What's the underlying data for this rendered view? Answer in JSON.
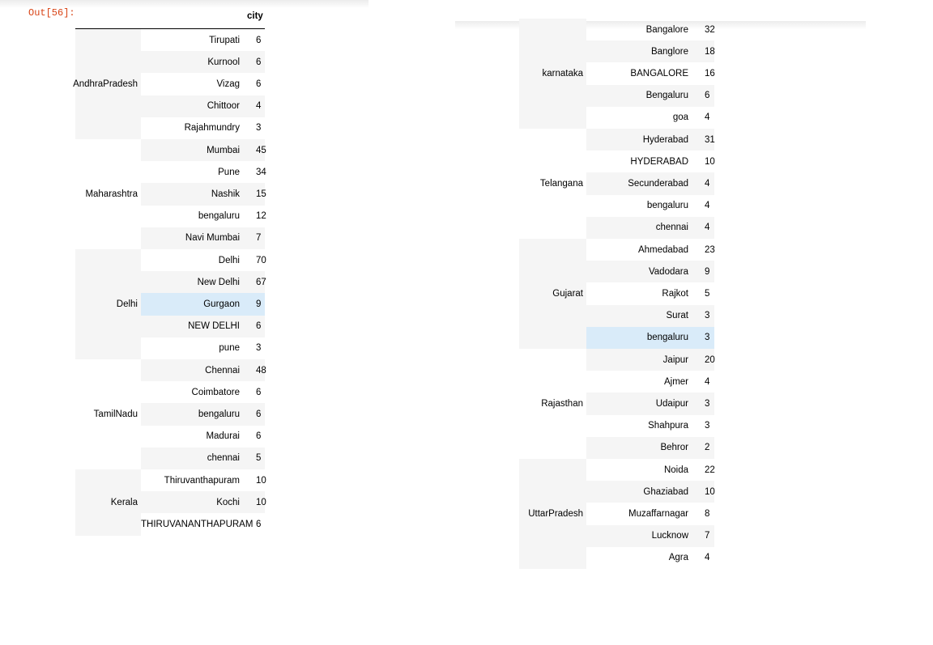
{
  "prompt_label": "Out[56]:",
  "header": {
    "column": "city"
  },
  "left_groups": [
    {
      "state": "AndhraPradesh",
      "rows": [
        {
          "city": "Tirupati",
          "count": "6"
        },
        {
          "city": "Kurnool",
          "count": "6"
        },
        {
          "city": "Vizag",
          "count": "6"
        },
        {
          "city": "Chittoor",
          "count": "4"
        },
        {
          "city": "Rajahmundry",
          "count": "3"
        }
      ]
    },
    {
      "state": "Maharashtra",
      "rows": [
        {
          "city": "Mumbai",
          "count": "45"
        },
        {
          "city": "Pune",
          "count": "34"
        },
        {
          "city": "Nashik",
          "count": "15"
        },
        {
          "city": "bengaluru",
          "count": "12"
        },
        {
          "city": "Navi Mumbai",
          "count": "7"
        }
      ]
    },
    {
      "state": "Delhi",
      "rows": [
        {
          "city": "Delhi",
          "count": "70"
        },
        {
          "city": "New Delhi",
          "count": "67"
        },
        {
          "city": "Gurgaon",
          "count": "9",
          "hover": true
        },
        {
          "city": "NEW DELHI",
          "count": "6"
        },
        {
          "city": "pune",
          "count": "3"
        }
      ]
    },
    {
      "state": "TamilNadu",
      "rows": [
        {
          "city": "Chennai",
          "count": "48"
        },
        {
          "city": "Coimbatore",
          "count": "6"
        },
        {
          "city": "bengaluru",
          "count": "6"
        },
        {
          "city": "Madurai",
          "count": "6"
        },
        {
          "city": "chennai",
          "count": "5"
        }
      ]
    },
    {
      "state": "Kerala",
      "rows": [
        {
          "city": "Thiruvanthapuram",
          "count": "10"
        },
        {
          "city": "Kochi",
          "count": "10"
        },
        {
          "city": "THIRUVANANTHAPURAM",
          "count": "6"
        }
      ]
    }
  ],
  "right_groups": [
    {
      "state": "karnataka",
      "rows": [
        {
          "city": "Bangalore",
          "count": "32"
        },
        {
          "city": "Banglore",
          "count": "18"
        },
        {
          "city": "BANGALORE",
          "count": "16"
        },
        {
          "city": "Bengaluru",
          "count": "6"
        },
        {
          "city": "goa",
          "count": "4"
        }
      ]
    },
    {
      "state": "Telangana",
      "rows": [
        {
          "city": "Hyderabad",
          "count": "31"
        },
        {
          "city": "HYDERABAD",
          "count": "10"
        },
        {
          "city": "Secunderabad",
          "count": "4"
        },
        {
          "city": "bengaluru",
          "count": "4"
        },
        {
          "city": "chennai",
          "count": "4"
        }
      ]
    },
    {
      "state": "Gujarat",
      "rows": [
        {
          "city": "Ahmedabad",
          "count": "23"
        },
        {
          "city": "Vadodara",
          "count": "9"
        },
        {
          "city": "Rajkot",
          "count": "5"
        },
        {
          "city": "Surat",
          "count": "3"
        },
        {
          "city": "bengaluru",
          "count": "3",
          "hover": true
        }
      ]
    },
    {
      "state": "Rajasthan",
      "rows": [
        {
          "city": "Jaipur",
          "count": "20"
        },
        {
          "city": "Ajmer",
          "count": "4"
        },
        {
          "city": "Udaipur",
          "count": "3"
        },
        {
          "city": "Shahpura",
          "count": "3"
        },
        {
          "city": "Behror",
          "count": "2"
        }
      ]
    },
    {
      "state": "UttarPradesh",
      "rows": [
        {
          "city": "Noida",
          "count": "22"
        },
        {
          "city": "Ghaziabad",
          "count": "10"
        },
        {
          "city": "Muzaffarnagar",
          "count": "8"
        },
        {
          "city": "Lucknow",
          "count": "7"
        },
        {
          "city": "Agra",
          "count": "4"
        }
      ]
    }
  ],
  "colors": {
    "stripe": "#f5f5f5",
    "hover": "#d9ebf9",
    "prompt": "#d84315"
  }
}
